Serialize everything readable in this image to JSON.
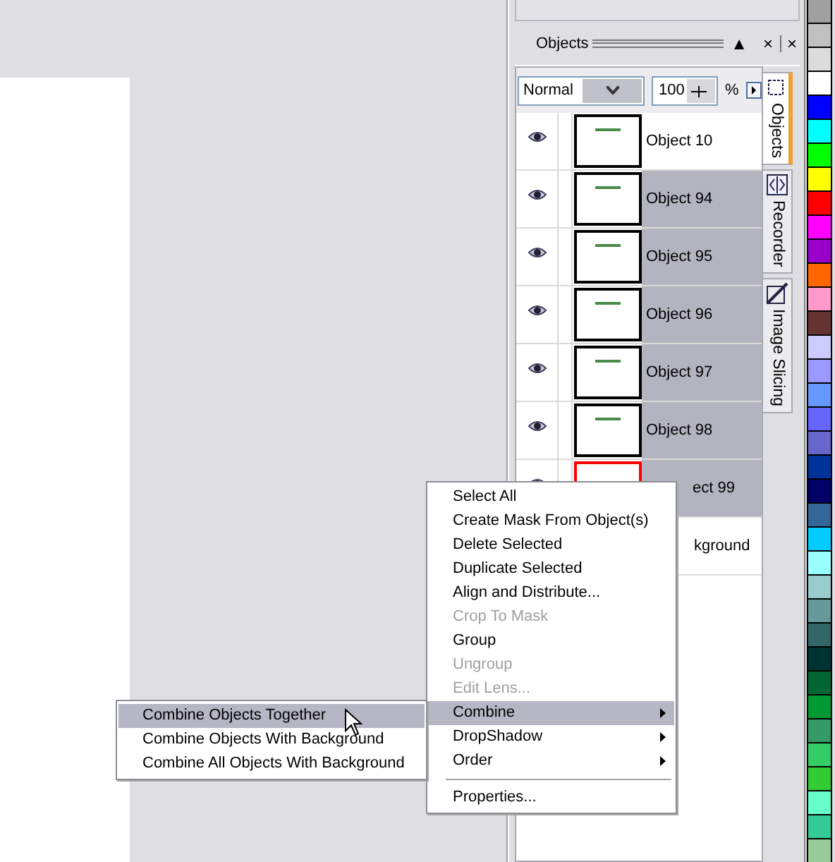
{
  "panel": {
    "title": "Objects",
    "collapse_glyph": "▲",
    "close_glyph": "×",
    "close_glyph_2": "×"
  },
  "toolbar": {
    "blend_mode": "Normal",
    "opacity": "100",
    "percent": "%"
  },
  "objects": [
    {
      "kind": "object",
      "name": "Object 10",
      "selected": false,
      "highlighted": false
    },
    {
      "kind": "object",
      "name": "Object 94",
      "selected": true,
      "highlighted": false
    },
    {
      "kind": "object",
      "name": "Object 95",
      "selected": true,
      "highlighted": false
    },
    {
      "kind": "object",
      "name": "Object 96",
      "selected": true,
      "highlighted": false
    },
    {
      "kind": "object",
      "name": "Object 97",
      "selected": true,
      "highlighted": false
    },
    {
      "kind": "object",
      "name": "Object 98",
      "selected": true,
      "highlighted": false
    },
    {
      "kind": "object",
      "name": "ect 99",
      "selected": true,
      "highlighted": true
    },
    {
      "kind": "background",
      "name": "kground",
      "selected": false
    }
  ],
  "side_tabs": [
    {
      "label": "Objects",
      "selected": true
    },
    {
      "label": "Recorder",
      "selected": false
    },
    {
      "label": "Image Slicing",
      "selected": false
    }
  ],
  "palette": [
    {
      "color": "#a0a0a0"
    },
    {
      "color": "#c0c0c0"
    },
    {
      "color": "#dcdcdc"
    },
    {
      "color": "#ffffff"
    },
    {
      "color": "#0000ff"
    },
    {
      "color": "#00ffff"
    },
    {
      "color": "#00ff00"
    },
    {
      "color": "#ffff00"
    },
    {
      "color": "#ff0000"
    },
    {
      "color": "#ff00ff"
    },
    {
      "color": "#9900cc"
    },
    {
      "color": "#ff6600"
    },
    {
      "color": "#ff99cc"
    },
    {
      "color": "#663333"
    },
    {
      "color": "#ccccff"
    },
    {
      "color": "#9999ff"
    },
    {
      "color": "#6699ff"
    },
    {
      "color": "#6666ff"
    },
    {
      "color": "#6666cc"
    },
    {
      "color": "#003399"
    },
    {
      "color": "#000066"
    },
    {
      "color": "#336699"
    },
    {
      "color": "#00ccff"
    },
    {
      "color": "#99ffff"
    },
    {
      "color": "#99cccc"
    },
    {
      "color": "#669999"
    },
    {
      "color": "#336666"
    },
    {
      "color": "#003333"
    },
    {
      "color": "#006633"
    },
    {
      "color": "#009933"
    },
    {
      "color": "#339966"
    },
    {
      "color": "#33cc66"
    },
    {
      "color": "#33cc33"
    },
    {
      "color": "#66ffcc"
    },
    {
      "color": "#33cc99"
    },
    {
      "color": "#99cc99"
    }
  ],
  "context_menu": [
    {
      "kind": "item",
      "label": "Select All",
      "disabled": false,
      "selected": false
    },
    {
      "kind": "item",
      "label": "Create Mask From Object(s)",
      "disabled": false,
      "selected": false
    },
    {
      "kind": "item",
      "label": "Delete Selected",
      "disabled": false,
      "selected": false
    },
    {
      "kind": "item",
      "label": "Duplicate Selected",
      "disabled": false,
      "selected": false
    },
    {
      "kind": "item",
      "label": "Align and Distribute...",
      "disabled": false,
      "selected": false
    },
    {
      "kind": "item",
      "label": "Crop To Mask",
      "disabled": true,
      "selected": false
    },
    {
      "kind": "item",
      "label": "Group",
      "disabled": false,
      "selected": false
    },
    {
      "kind": "item",
      "label": "Ungroup",
      "disabled": true,
      "selected": false
    },
    {
      "kind": "item",
      "label": "Edit Lens...",
      "disabled": true,
      "selected": false
    },
    {
      "kind": "submenu",
      "label": "Combine",
      "disabled": false,
      "selected": true
    },
    {
      "kind": "submenu",
      "label": "DropShadow",
      "disabled": false,
      "selected": false
    },
    {
      "kind": "submenu",
      "label": "Order",
      "disabled": false,
      "selected": false
    },
    {
      "kind": "separator"
    },
    {
      "kind": "item",
      "label": "Properties...",
      "disabled": false,
      "selected": false
    }
  ],
  "submenu": [
    {
      "label": "Combine Objects Together",
      "selected": true
    },
    {
      "label": "Combine Objects With Background",
      "selected": false
    },
    {
      "label": "Combine All Objects With Background",
      "selected": false
    }
  ]
}
